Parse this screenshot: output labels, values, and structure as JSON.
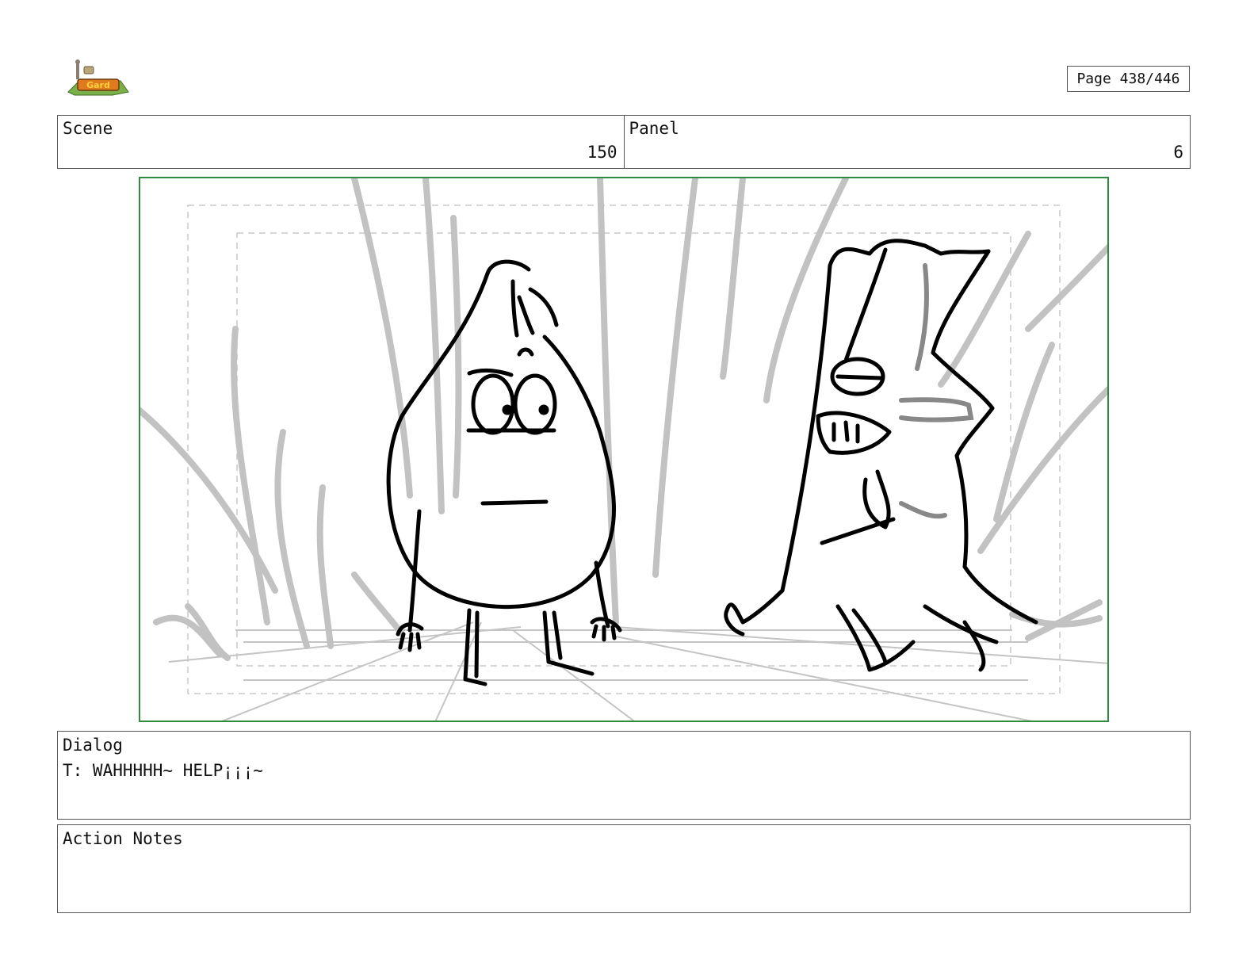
{
  "header": {
    "logo_icon": "show-logo-icon",
    "page_label": "Page 438/446"
  },
  "info": {
    "scene_label": "Scene",
    "scene_value": "150",
    "panel_label": "Panel",
    "panel_value": "6"
  },
  "panel_image": {
    "description_icon": "storyboard-sketch-icon",
    "frame_color": "#2e8b3e"
  },
  "dialog": {
    "label": "Dialog",
    "text": "T: WAHHHHH~ HELP¡¡¡~"
  },
  "action_notes": {
    "label": "Action Notes",
    "text": ""
  }
}
